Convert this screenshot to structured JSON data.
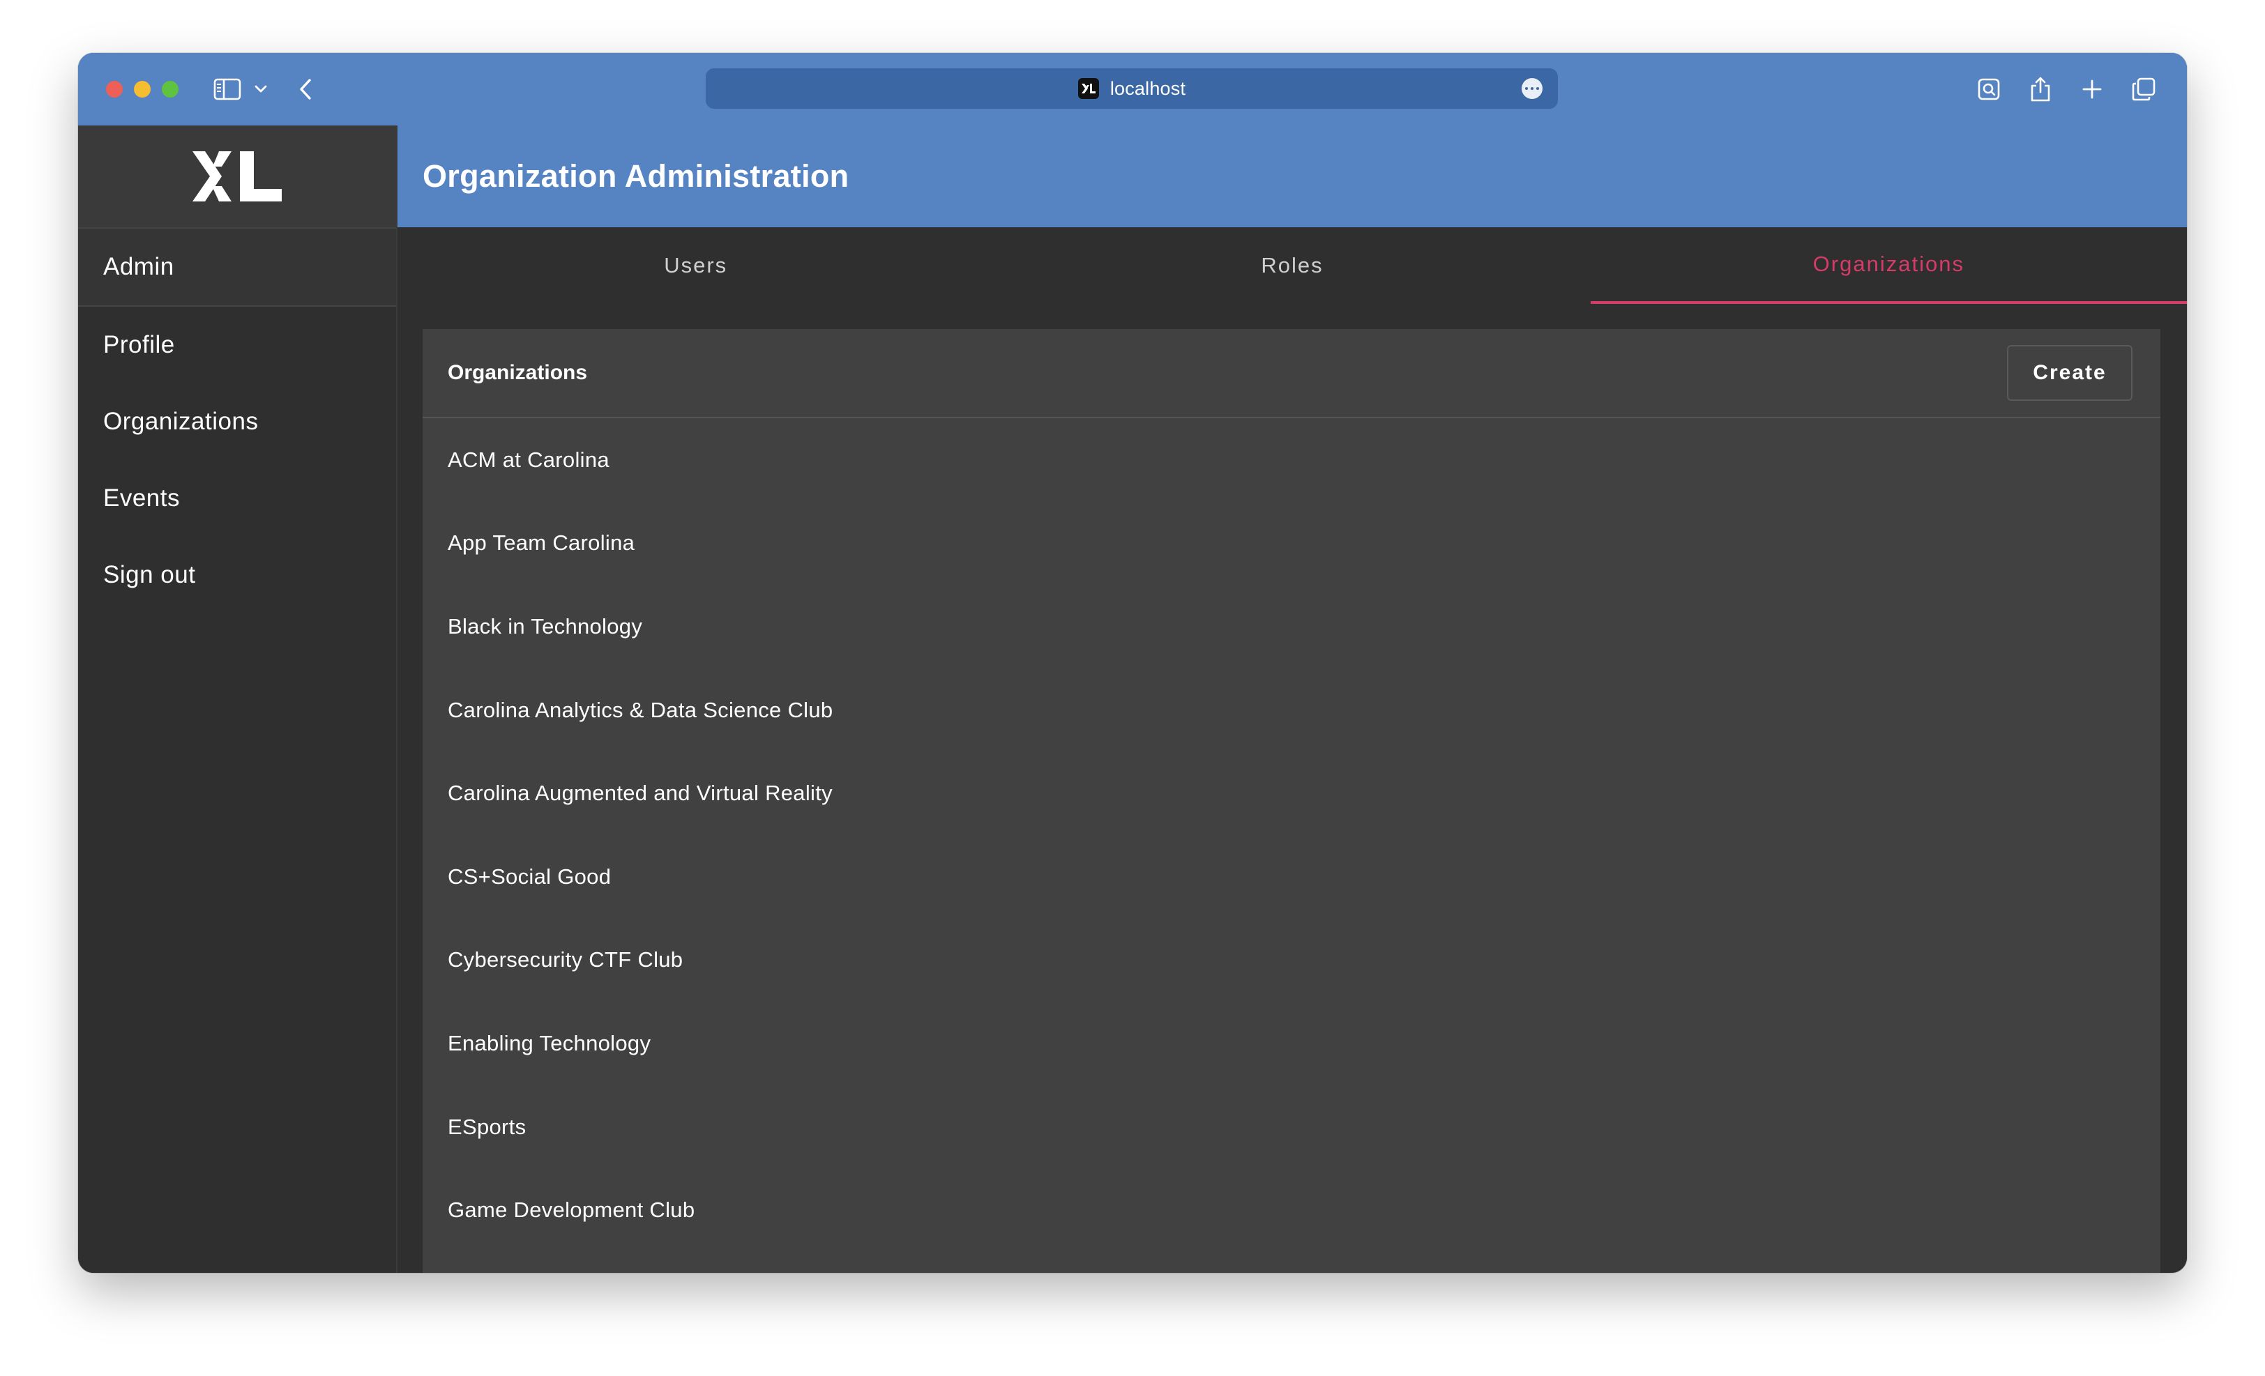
{
  "browser": {
    "url": "localhost",
    "icons": {
      "sidebar_toggle": "sidebar-icon",
      "chevron": "chevron-down-icon",
      "back": "chevron-left-icon",
      "more": "ellipsis-icon",
      "reader": "reader-icon",
      "share": "share-icon",
      "new_tab": "plus-icon",
      "tabs": "tabs-overview-icon"
    }
  },
  "sidebar": {
    "logo": "XL",
    "items": [
      {
        "label": "Admin"
      },
      {
        "label": "Profile"
      },
      {
        "label": "Organizations"
      },
      {
        "label": "Events"
      },
      {
        "label": "Sign out"
      }
    ]
  },
  "main": {
    "title": "Organization Administration",
    "tabs": [
      {
        "label": "Users",
        "active": false
      },
      {
        "label": "Roles",
        "active": false
      },
      {
        "label": "Organizations",
        "active": true
      }
    ],
    "card": {
      "title": "Organizations",
      "create_label": "Create",
      "organizations": [
        "ACM at Carolina",
        "App Team Carolina",
        "Black in Technology",
        "Carolina Analytics & Data Science Club",
        "Carolina Augmented and Virtual Reality",
        "CS+Social Good",
        "Cybersecurity CTF Club",
        "Enabling Technology",
        "ESports",
        "Game Development Club"
      ]
    }
  },
  "colors": {
    "header_blue": "#5683c2",
    "url_bar": "#3b68a4",
    "sidebar_bg": "#2f2f2f",
    "card_bg": "#414141",
    "active_tab": "#d73b6a"
  }
}
